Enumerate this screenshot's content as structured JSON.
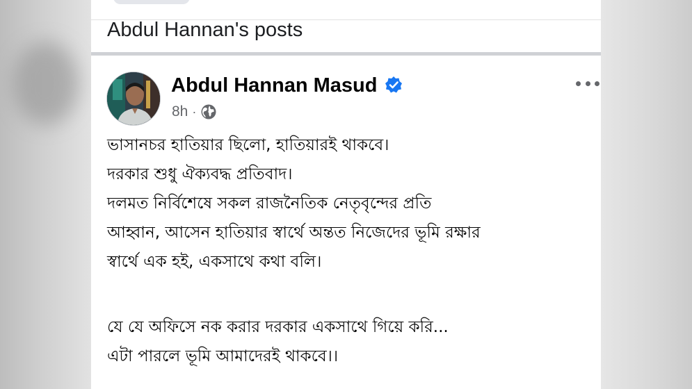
{
  "section": {
    "title": "Abdul Hannan's posts"
  },
  "post": {
    "author": "Abdul Hannan Masud",
    "time": "8h",
    "separator": "·",
    "privacy_icon": "globe-icon",
    "verified_icon": "verified-badge-icon",
    "more_icon": "more-options-icon",
    "paragraph1": [
      "ভাসানচর হাতিয়ার ছিলো, হাতিয়ারই থাকবে।",
      "দরকার শুধু ঐক্যবদ্ধ প্রতিবাদ।",
      "দলমত নির্বিশেষে সকল রাজনৈতিক নেতৃবৃন্দের প্রতি",
      "আহ্বান, আসেন হাতিয়ার স্বার্থে অন্তত নিজেদের ভূমি রক্ষার",
      "স্বার্থে এক হই, একসাথে কথা বলি।"
    ],
    "paragraph2": [
      "যে যে অফিসে নক করার দরকার একসাথে গিয়ে করি...",
      "এটা পারলে ভূমি আমাদেরই থাকবে।।"
    ]
  },
  "colors": {
    "text": "#050505",
    "meta": "#65676b",
    "verified": "#1877f2",
    "divider": "#cfd1d5"
  }
}
